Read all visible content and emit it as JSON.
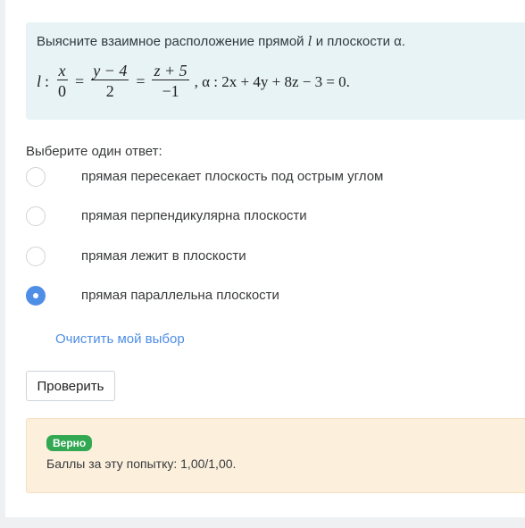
{
  "question": {
    "prompt_before": "Выясните взаимное расположение прямой ",
    "prompt_var": "l",
    "prompt_middle": " и плоскости ",
    "prompt_alpha": "α",
    "prompt_end": ".",
    "equation": {
      "line_name": "l",
      "colon": ":",
      "frac1_num": "x",
      "frac1_den": "0",
      "frac2_num": "y − 4",
      "frac2_den": "2",
      "frac3_num": "z + 5",
      "frac3_den": "−1",
      "equals": "=",
      "plane": ", α : 2x + 4y + 8z − 3 = 0."
    }
  },
  "choose_label": "Выберите один ответ:",
  "options": [
    {
      "label": "прямая пересекает плоскость под острым углом",
      "selected": false
    },
    {
      "label": "прямая перпендикулярна плоскости",
      "selected": false
    },
    {
      "label": "прямая лежит в плоскости",
      "selected": false
    },
    {
      "label": "прямая параллельна плоскости",
      "selected": true
    }
  ],
  "clear_choice": "Очистить мой выбор",
  "check_button": "Проверить",
  "feedback": {
    "badge": "Верно",
    "score": "Баллы за эту попытку: 1,00/1,00."
  },
  "colors": {
    "accent": "#4e8ee6",
    "correct": "#32a852",
    "question_bg": "#e7f3f5",
    "feedback_bg": "#fcefdc"
  }
}
